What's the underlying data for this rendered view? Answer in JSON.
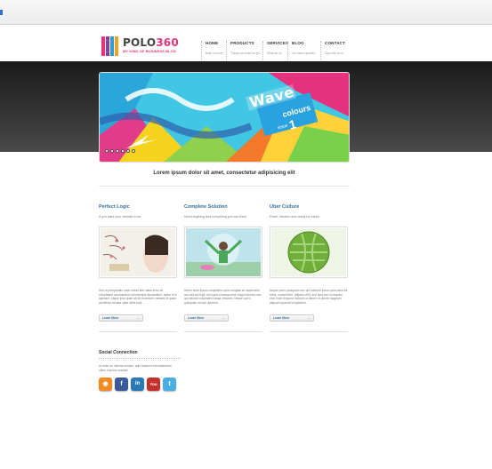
{
  "brand": {
    "name_part1": "POLO",
    "name_part2": "360",
    "tagline": "MY KIND OF BUSINESS BLOG"
  },
  "nav": [
    {
      "label": "HOME",
      "sub": "Back to home"
    },
    {
      "label": "PRODUCTS",
      "sub": "Things we make for you"
    },
    {
      "label": "SERVICES",
      "sub": "What we do"
    },
    {
      "label": "BLOG",
      "sub": "Our latest updates"
    },
    {
      "label": "CONTACT",
      "sub": "Say hello to us"
    }
  ],
  "slider": {
    "banner_title": "Wave",
    "banner_sub": "colours",
    "issue_label": "issue",
    "issue_number": "1",
    "dot_count": 6
  },
  "headline": "Lorem ipsum dolor sit amet, consectetur adipisicing elit",
  "columns": [
    {
      "title": "Perfect Logic",
      "subtitle": "If you want your website to be",
      "body": "Sed ut perspiciatis unde omnis iste natus error sit voluptatem accusantium doloremque laudantium, totam rem aperiam, eaque ipsa quae ab illo inventore veritatis et quasi architecto beatae vitae dicta sunt.",
      "more_label": "Learn More"
    },
    {
      "title": "Complete Solution",
      "subtitle": "Need anything and everything you can think",
      "body": "Nemo enim ipsam voluptatem quia voluptas sit aspernatur aut odit aut fugit, sed quia consequuntur magni dolores eos qui ratione voluptatem sequi nesciunt. Neque porro quisquam est qui dolorem.",
      "more_label": "Learn More"
    },
    {
      "title": "Uber Culture",
      "subtitle": "Fresh, Modern and ready for future",
      "body": "Neque porro quisquam est, qui dolorem ipsum quia dolor sit amet, consectetur, adipisci velit, sed quia non numquam eius modi tempora incidunt ut labore et dolore magnam aliquam quaerat voluptatem.",
      "more_label": "Learn More"
    }
  ],
  "social": {
    "title": "Social Connection",
    "body": "Ut enim ad minima veniam, quis nostrum exercitationem ullam corporis suscipit.",
    "icons": [
      {
        "name": "rss-icon",
        "glyph": "◉",
        "color": "#f08a24"
      },
      {
        "name": "facebook-icon",
        "glyph": "f",
        "color": "#3b5a9a"
      },
      {
        "name": "linkedin-icon",
        "glyph": "in",
        "color": "#2a7ab8"
      },
      {
        "name": "youtube-icon",
        "glyph": "You",
        "color": "#c4302b"
      },
      {
        "name": "twitter-icon",
        "glyph": "t",
        "color": "#4aaee3"
      }
    ]
  },
  "colors": {
    "accent_blue": "#2f6fa3",
    "brand_pink": "#e2357a",
    "band_dark": "#1c1c1c"
  }
}
